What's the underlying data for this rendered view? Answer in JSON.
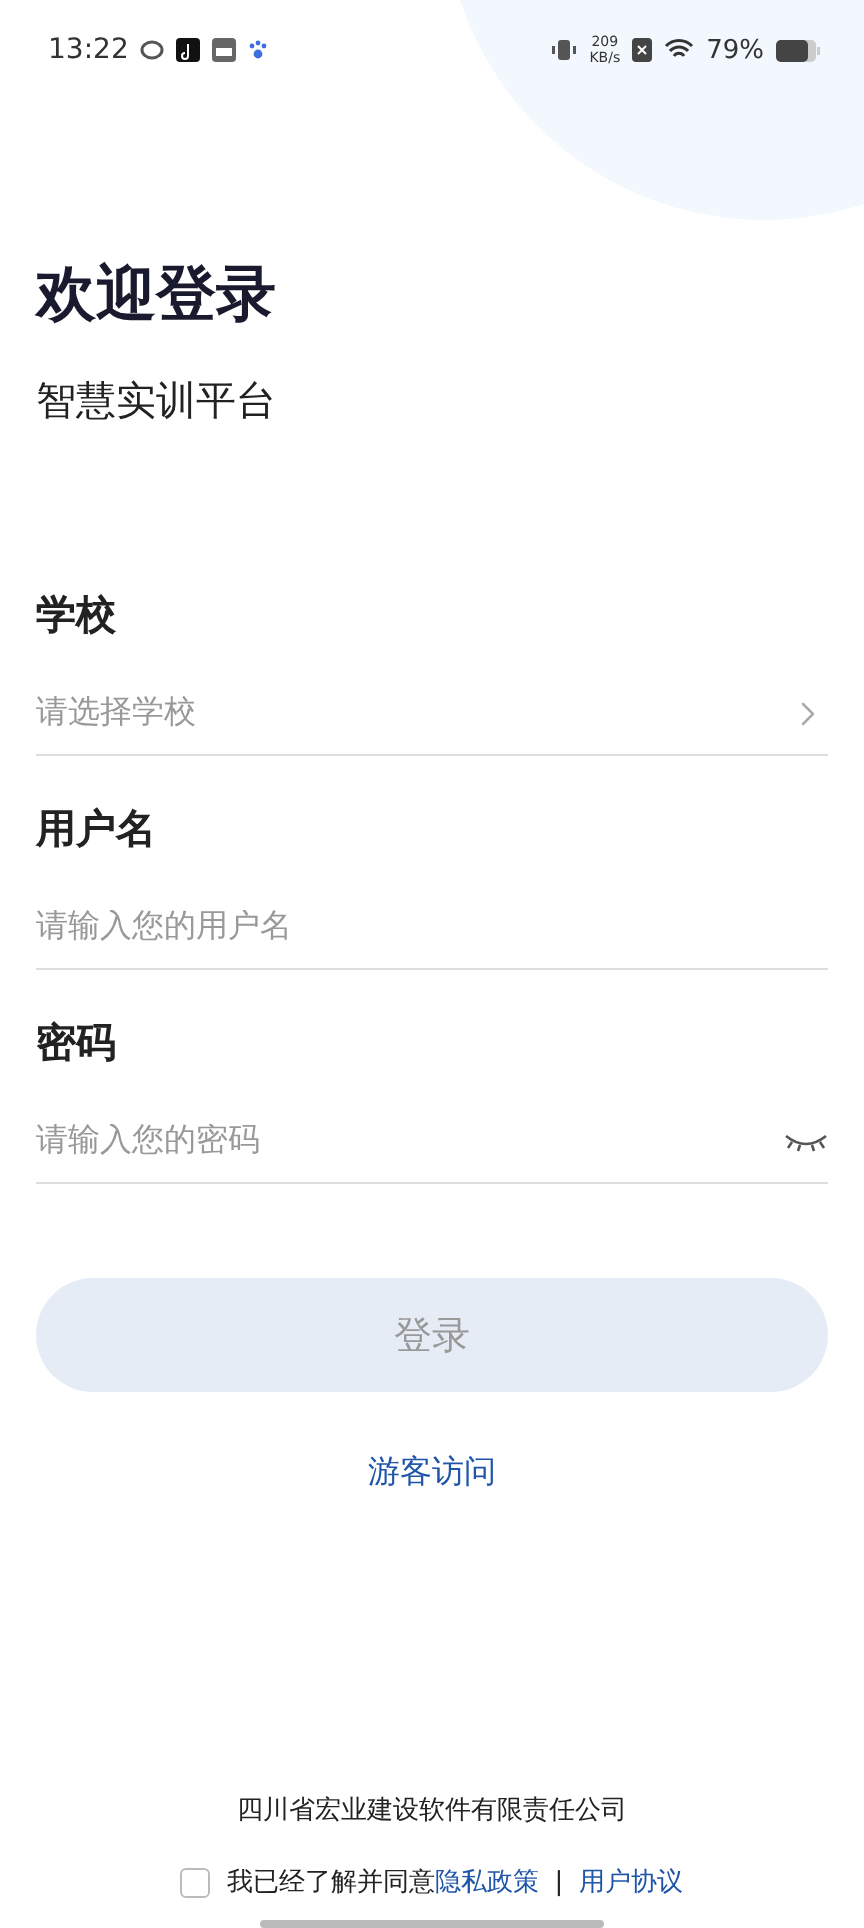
{
  "status_bar": {
    "time": "13:22",
    "speed_value": "209",
    "speed_unit": "KB/s",
    "battery": "79%"
  },
  "title": "欢迎登录",
  "subtitle": "智慧实训平台",
  "fields": [
    {
      "kind": "select",
      "label": "学校",
      "placeholder": "请选择学校"
    },
    {
      "kind": "text",
      "label": "用户名",
      "placeholder": "请输入您的用户名"
    },
    {
      "kind": "password",
      "label": "密码",
      "placeholder": "请输入您的密码"
    }
  ],
  "login_button": {
    "label": "登录",
    "disabled": true
  },
  "guest_link": "游客访问",
  "company": "四川省宏业建设软件有限责任公司",
  "agreement": {
    "checked": false,
    "text": "我已经了解并同意",
    "privacy": "隐私政策",
    "separator": "|",
    "terms": "用户协议"
  }
}
